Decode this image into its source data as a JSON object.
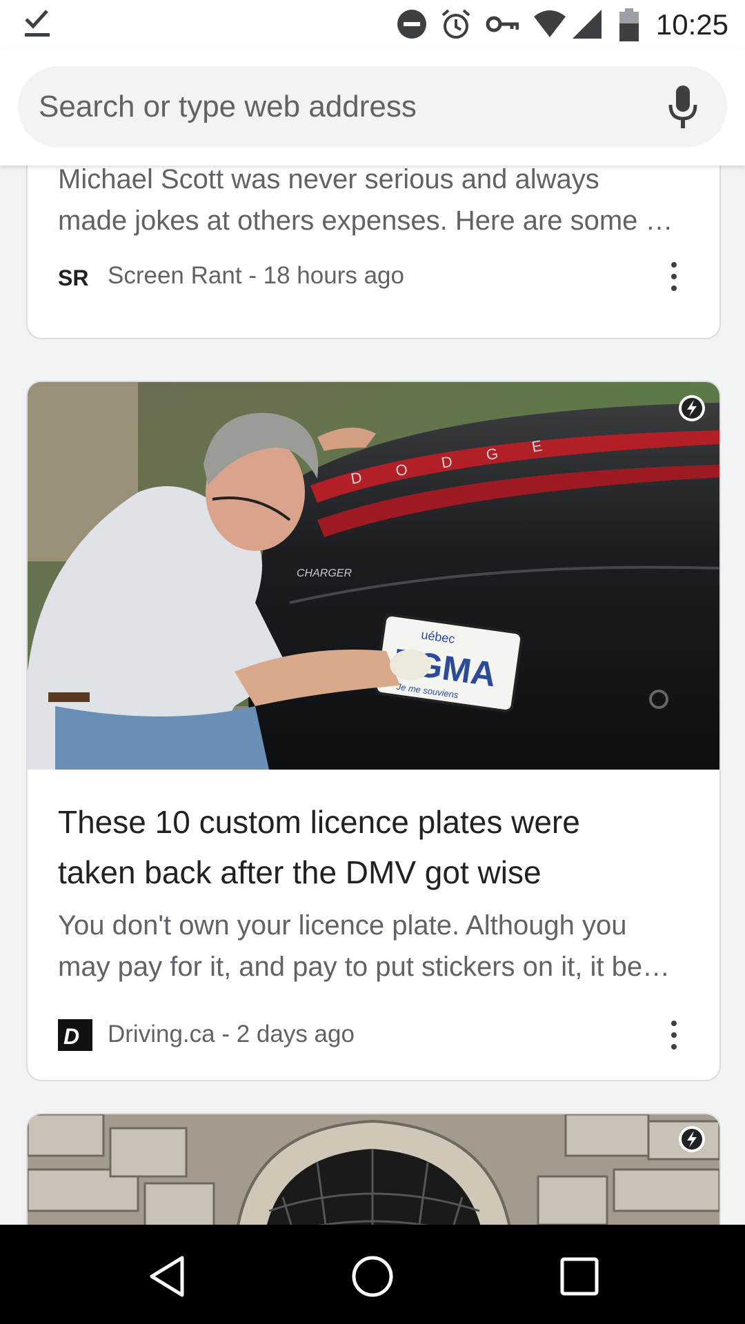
{
  "status_bar": {
    "time": "10:25",
    "icons": [
      "download-done-icon",
      "do-not-disturb-icon",
      "alarm-icon",
      "vpn-key-icon",
      "wifi-icon",
      "cell-signal-icon",
      "battery-icon"
    ]
  },
  "search": {
    "placeholder": "Search or type web address",
    "mic_icon": "mic-icon"
  },
  "feed": {
    "cards": [
      {
        "snippet_lines": [
          "Michael Scott was never serious and always",
          "made jokes at others expenses. Here are some …"
        ],
        "source": "Screen Rant - 18 hours ago",
        "source_logo": "SR"
      },
      {
        "image_text": {
          "brand": "CHARGER",
          "plate": "EGMA",
          "plate_top": "uébec",
          "plate_bottom": "Je me souviens",
          "car_letters": "D O D G E"
        },
        "headline_lines": [
          "These 10 custom licence plates were",
          "taken back after the DMV got wise"
        ],
        "snippet_lines": [
          "You don't own your licence plate. Although you",
          "may pay for it, and pay to put stickers on it, it be…"
        ],
        "source": "Driving.ca - 2 days ago",
        "source_logo": "D"
      },
      {
        "image": "stone-archway-photo"
      }
    ]
  },
  "nav_bar": {
    "icons": [
      "back-icon",
      "home-icon",
      "recents-icon"
    ]
  },
  "colors": {
    "text_primary": "#202124",
    "text_secondary": "#5f6368",
    "card_border": "#dadce0",
    "background": "#f1f3f4"
  }
}
